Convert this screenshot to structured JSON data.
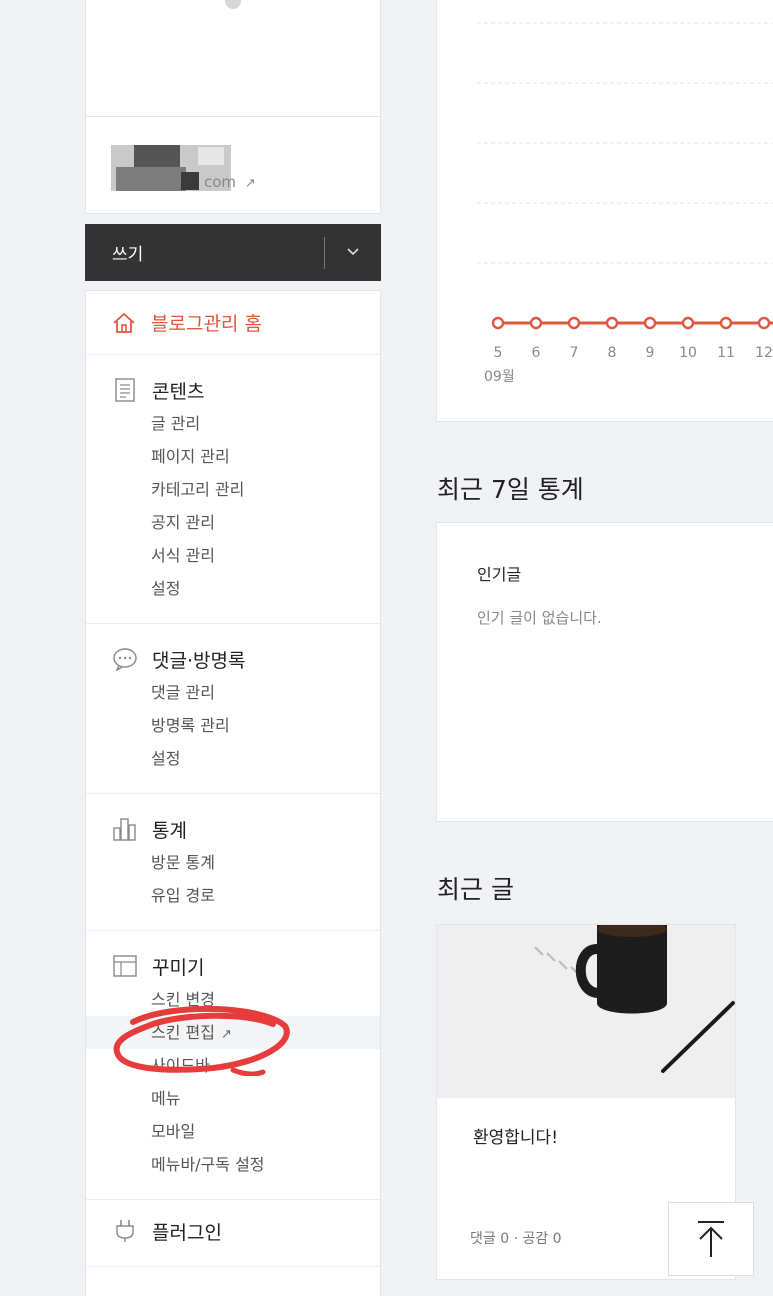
{
  "profile": {
    "blog_url_suffix": "com",
    "external_link_icon": "external-link-icon"
  },
  "write_bar": {
    "label": "쓰기",
    "dropdown_icon": "chevron-down-icon"
  },
  "menu": {
    "home": {
      "label": "블로그관리 홈",
      "icon": "home-icon"
    },
    "sections": [
      {
        "title": "콘텐츠",
        "icon": "document-icon",
        "items": [
          "글 관리",
          "페이지 관리",
          "카테고리 관리",
          "공지 관리",
          "서식 관리",
          "설정"
        ]
      },
      {
        "title": "댓글·방명록",
        "icon": "speech-bubble-icon",
        "items": [
          "댓글 관리",
          "방명록 관리",
          "설정"
        ]
      },
      {
        "title": "통계",
        "icon": "bar-chart-icon",
        "items": [
          "방문 통계",
          "유입 경로"
        ]
      },
      {
        "title": "꾸미기",
        "icon": "layout-icon",
        "items": [
          "스킨 변경",
          "스킨 편집",
          "사이드바",
          "메뉴",
          "모바일",
          "메뉴바/구독 설정"
        ]
      },
      {
        "title": "플러그인",
        "icon": "plug-icon",
        "items": []
      }
    ]
  },
  "chart_data": {
    "type": "line",
    "x": [
      "5",
      "6",
      "7",
      "8",
      "9",
      "10",
      "11",
      "12"
    ],
    "x_month_label": "09월",
    "series": [
      {
        "values": [
          0,
          0,
          0,
          0,
          0,
          0,
          0,
          0
        ]
      }
    ],
    "color": "#e0573f",
    "grid": true
  },
  "stats": {
    "section_title": "최근 7일 통계",
    "popular_heading": "인기글",
    "popular_empty": "인기 글이 없습니다."
  },
  "recent": {
    "section_title": "최근 글",
    "post_title": "환영합니다!",
    "post_meta": "댓글 0 · 공감 0"
  },
  "scroll_top_icon": "arrow-up-icon"
}
